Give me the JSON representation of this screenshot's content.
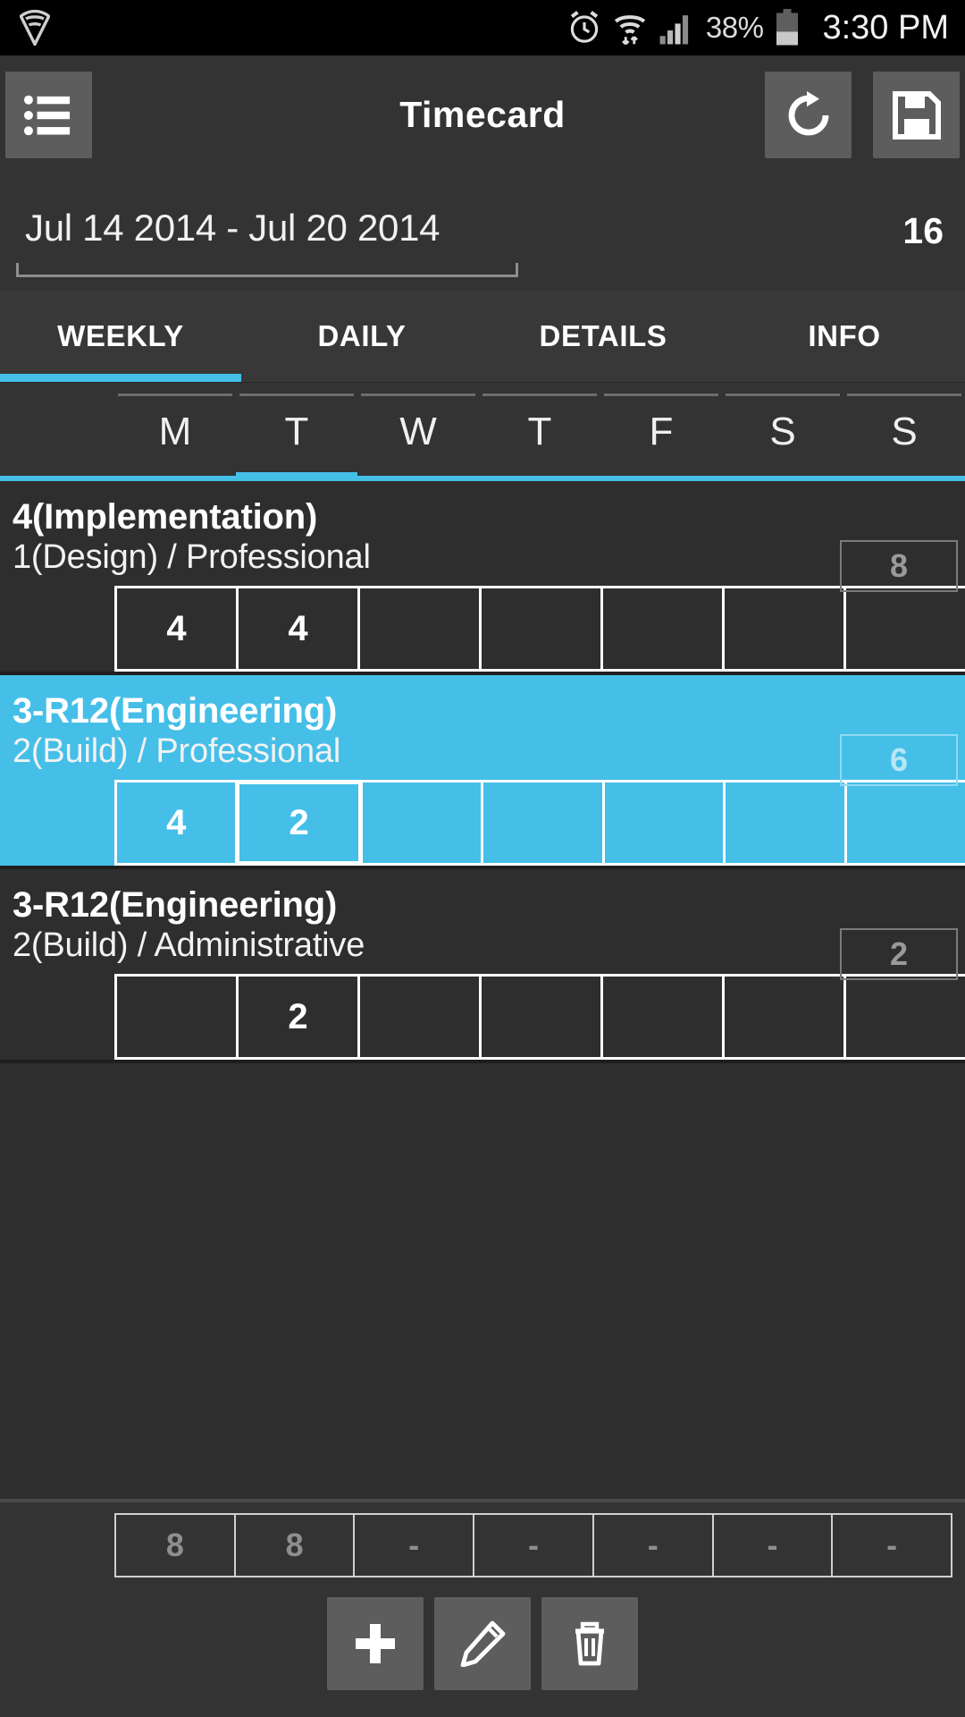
{
  "statusbar": {
    "vpn_icon": "vpn-shield-icon",
    "alarm_icon": "alarm-clock-icon",
    "wifi_icon": "wifi-icon",
    "signal_icon": "cellular-signal-icon",
    "battery_percent": "38%",
    "battery_icon": "battery-icon",
    "clock": "3:30 PM"
  },
  "appbar": {
    "menu_icon": "list-menu-icon",
    "title": "Timecard",
    "refresh_icon": "refresh-icon",
    "save_icon": "floppy-save-icon"
  },
  "daterow": {
    "range": "Jul 14 2014 - Jul 20 2014",
    "total": "16"
  },
  "tabs": [
    {
      "label": "WEEKLY",
      "active": true
    },
    {
      "label": "DAILY",
      "active": false
    },
    {
      "label": "DETAILS",
      "active": false
    },
    {
      "label": "INFO",
      "active": false
    }
  ],
  "days": [
    {
      "label": "M",
      "active": false
    },
    {
      "label": "T",
      "active": true
    },
    {
      "label": "W",
      "active": false
    },
    {
      "label": "T",
      "active": false
    },
    {
      "label": "F",
      "active": false
    },
    {
      "label": "S",
      "active": false
    },
    {
      "label": "S",
      "active": false
    }
  ],
  "rows": [
    {
      "title": "4(Implementation)",
      "subtitle": "1(Design) / Professional",
      "week_total": "8",
      "selected": false,
      "cells": [
        "4",
        "4",
        "",
        "",
        "",
        "",
        ""
      ],
      "selected_cell": -1
    },
    {
      "title": "3-R12(Engineering)",
      "subtitle": "2(Build) / Professional",
      "week_total": "6",
      "selected": true,
      "cells": [
        "4",
        "2",
        "",
        "",
        "",
        "",
        ""
      ],
      "selected_cell": 1
    },
    {
      "title": "3-R12(Engineering)",
      "subtitle": "2(Build) / Administrative",
      "week_total": "2",
      "selected": false,
      "cells": [
        "",
        "2",
        "",
        "",
        "",
        "",
        ""
      ],
      "selected_cell": -1
    }
  ],
  "day_totals": [
    "8",
    "8",
    "-",
    "-",
    "-",
    "-",
    "-"
  ],
  "actions": [
    {
      "name": "add-button",
      "icon": "plus-icon"
    },
    {
      "name": "edit-button",
      "icon": "pencil-icon"
    },
    {
      "name": "delete-button",
      "icon": "trash-icon"
    }
  ],
  "colors": {
    "accent": "#45bfe8",
    "appbar_bg": "#333333",
    "page_bg": "#2e2e2e",
    "button_bg": "#5d5d5d",
    "statusbar_bg": "#000000"
  }
}
